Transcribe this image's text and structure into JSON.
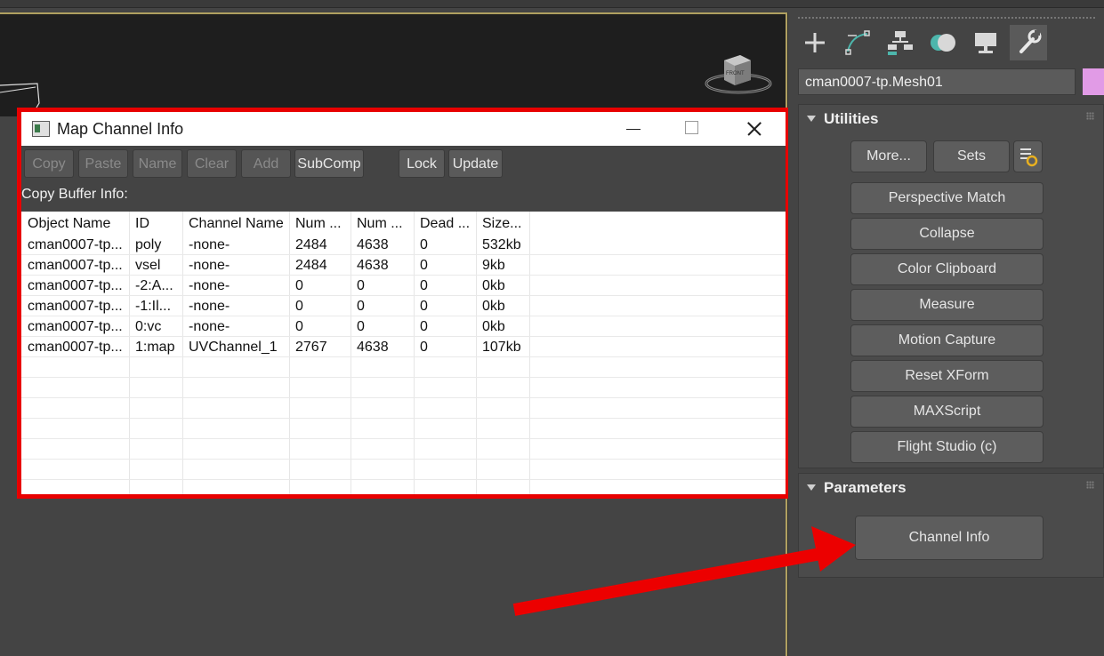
{
  "dialog": {
    "title": "Map Channel Info",
    "buttons": [
      {
        "label": "Copy",
        "enabled": false
      },
      {
        "label": "Paste",
        "enabled": false
      },
      {
        "label": "Name",
        "enabled": false
      },
      {
        "label": "Clear",
        "enabled": false
      },
      {
        "label": "Add",
        "enabled": false
      },
      {
        "label": "SubComp",
        "enabled": true
      },
      {
        "label": "Lock",
        "enabled": true
      },
      {
        "label": "Update",
        "enabled": true
      }
    ],
    "copy_buffer_label": "Copy Buffer Info:",
    "columns": [
      "Object Name",
      "ID",
      "Channel Name",
      "Num ...",
      "Num ...",
      "Dead ...",
      "Size..."
    ],
    "rows": [
      [
        "cman0007-tp...",
        "poly",
        "-none-",
        "2484",
        "4638",
        "0",
        "532kb"
      ],
      [
        "cman0007-tp...",
        "vsel",
        "-none-",
        "2484",
        "4638",
        "0",
        "9kb"
      ],
      [
        "cman0007-tp...",
        "-2:A...",
        "-none-",
        "0",
        "0",
        "0",
        "0kb"
      ],
      [
        "cman0007-tp...",
        "-1:Il...",
        "-none-",
        "0",
        "0",
        "0",
        "0kb"
      ],
      [
        "cman0007-tp...",
        "0:vc",
        "-none-",
        "0",
        "0",
        "0",
        "0kb"
      ],
      [
        "cman0007-tp...",
        "1:map",
        "UVChannel_1",
        "2767",
        "4638",
        "0",
        "107kb"
      ]
    ]
  },
  "panel": {
    "tabs": [
      "create-icon",
      "modify-icon",
      "hierarchy-icon",
      "motion-icon",
      "display-icon",
      "utilities-icon"
    ],
    "object_name": "cman0007-tp.Mesh01",
    "object_color": "#e19be6",
    "utilities": {
      "title": "Utilities",
      "more_label": "More...",
      "sets_label": "Sets",
      "items": [
        "Perspective Match",
        "Collapse",
        "Color Clipboard",
        "Measure",
        "Motion Capture",
        "Reset XForm",
        "MAXScript",
        "Flight Studio (c)"
      ]
    },
    "parameters": {
      "title": "Parameters",
      "channel_info_label": "Channel Info"
    }
  },
  "colors": {
    "highlight": "#e80000",
    "panel_bg": "#444444",
    "viewport_dark": "#1e1e1e"
  }
}
